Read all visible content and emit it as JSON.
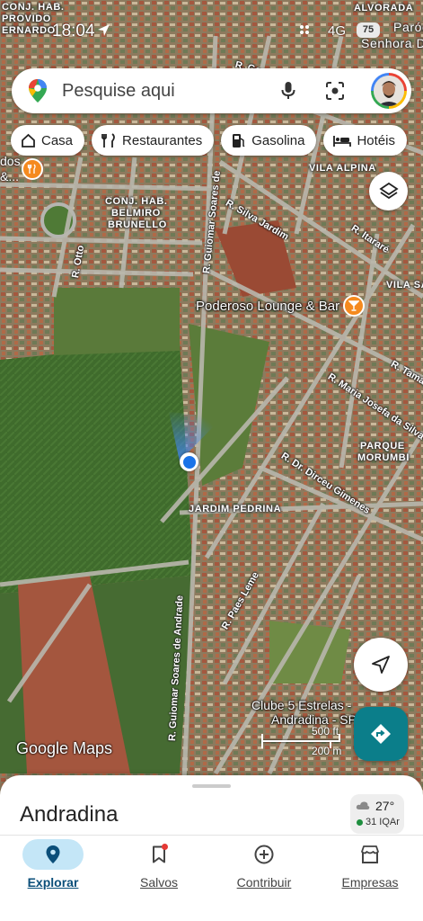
{
  "status_bar": {
    "time": "18:04",
    "network": "4G",
    "battery": "75"
  },
  "search": {
    "placeholder": "Pesquise aqui"
  },
  "chips": [
    {
      "label": "Casa",
      "icon": "home-icon"
    },
    {
      "label": "Restaurantes",
      "icon": "fork-knife-icon"
    },
    {
      "label": "Gasolina",
      "icon": "gas-pump-icon"
    },
    {
      "label": "Hotéis",
      "icon": "bed-icon"
    }
  ],
  "map": {
    "neighborhood_labels": {
      "conj_top_1": "CONJ. HAB.",
      "conj_top_2": "PROVIDO",
      "conj_top_3": "ERNARDO",
      "alvorada": "ALVORADA",
      "paroq_1": "Paróq",
      "paroq_2": "Senhora D",
      "vila_alpina": "VILA ALPINA",
      "conj_belmiro_1": "CONJ. HAB.",
      "conj_belmiro_2": "BELMIRO",
      "conj_belmiro_3": "BRUNELLO",
      "vila_sa": "VILA SA",
      "parque_1": "PARQUE",
      "parque_2": "MORUMBI",
      "jardim_pedrina": "JARDIM PEDRINA",
      "dos": "dos",
      "amp": "&..."
    },
    "streets": {
      "guiomar_top": "R. Guiomar Soares de",
      "guiomar_bottom": "R. Guiomar Soares de Andrade",
      "silva_jardim": "R. Silva Jardim",
      "itarare": "R. Itararé",
      "otto": "R. Otto",
      "maria_josefa": "R. Maria Josefa da Silva",
      "tamar": "R. Tamar",
      "dirceu": "R. Dr. Dirceu Gimenes",
      "paes_leme": "R. Paes Leme",
      "r_ge": "R. Ge"
    },
    "places": {
      "poderoso": "Poderoso Lounge & Bar",
      "clube_1": "Clube 5 Estrelas -",
      "clube_2": "Andradina - SP"
    },
    "attribution": "Google Maps",
    "scale": {
      "imperial": "500 ft",
      "metric": "200 m"
    }
  },
  "sheet": {
    "city": "Andradina",
    "weather": {
      "temp": "27°",
      "air_quality": "31 IQAr"
    }
  },
  "nav": [
    {
      "label": "Explorar",
      "icon": "explore-pin-icon",
      "active": true
    },
    {
      "label": "Salvos",
      "icon": "bookmark-icon",
      "active": false
    },
    {
      "label": "Contribuir",
      "icon": "add-circle-icon",
      "active": false
    },
    {
      "label": "Empresas",
      "icon": "storefront-icon",
      "active": false
    }
  ],
  "colors": {
    "accent": "#1a73e8",
    "directions": "#0b7e8a",
    "nav_active_bg": "#c4e6f7",
    "poi_orange": "#f58a1f"
  }
}
